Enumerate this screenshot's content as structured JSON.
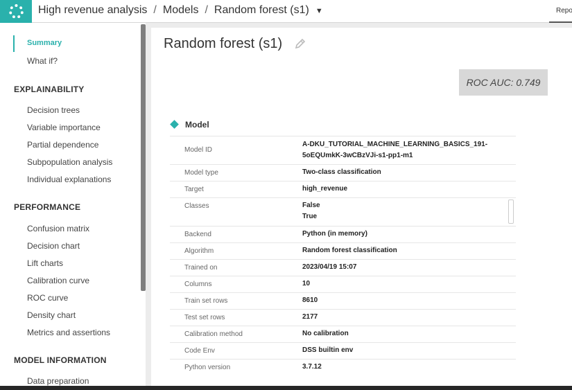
{
  "header": {
    "breadcrumb": [
      "High revenue analysis",
      "Models",
      "Random forest (s1)"
    ],
    "right_tab": "Repo"
  },
  "sidebar": {
    "top_items": [
      "Summary",
      "What if?"
    ],
    "sections": [
      {
        "title": "EXPLAINABILITY",
        "items": [
          "Decision trees",
          "Variable importance",
          "Partial dependence",
          "Subpopulation analysis",
          "Individual explanations"
        ]
      },
      {
        "title": "PERFORMANCE",
        "items": [
          "Confusion matrix",
          "Decision chart",
          "Lift charts",
          "Calibration curve",
          "ROC curve",
          "Density chart",
          "Metrics and assertions"
        ]
      },
      {
        "title": "MODEL INFORMATION",
        "items": [
          "Data preparation"
        ]
      }
    ],
    "active": "Summary"
  },
  "main": {
    "title": "Random forest (s1)",
    "roc_badge": "ROC AUC: 0.749",
    "section_title": "Model",
    "rows": [
      {
        "key": "Model ID",
        "value": "A-DKU_TUTORIAL_MACHINE_LEARNING_BASICS_191-\n5oEQUmkK-3wCBzVJi-s1-pp1-m1"
      },
      {
        "key": "Model type",
        "value": "Two-class classification"
      },
      {
        "key": "Target",
        "value": "high_revenue"
      },
      {
        "key": "Classes",
        "value": "False\nTrue"
      },
      {
        "key": "Backend",
        "value": "Python (in memory)"
      },
      {
        "key": "Algorithm",
        "value": "Random forest classification"
      },
      {
        "key": "Trained on",
        "value": "2023/04/19 15:07"
      },
      {
        "key": "Columns",
        "value": "10"
      },
      {
        "key": "Train set rows",
        "value": "8610"
      },
      {
        "key": "Test set rows",
        "value": "2177"
      },
      {
        "key": "Calibration method",
        "value": "No calibration"
      },
      {
        "key": "Code Env",
        "value": "DSS builtin env"
      },
      {
        "key": "Python version",
        "value": "3.7.12"
      }
    ]
  },
  "colors": {
    "accent": "#2ab1ac",
    "roc_bg": "#d8d8d8"
  }
}
